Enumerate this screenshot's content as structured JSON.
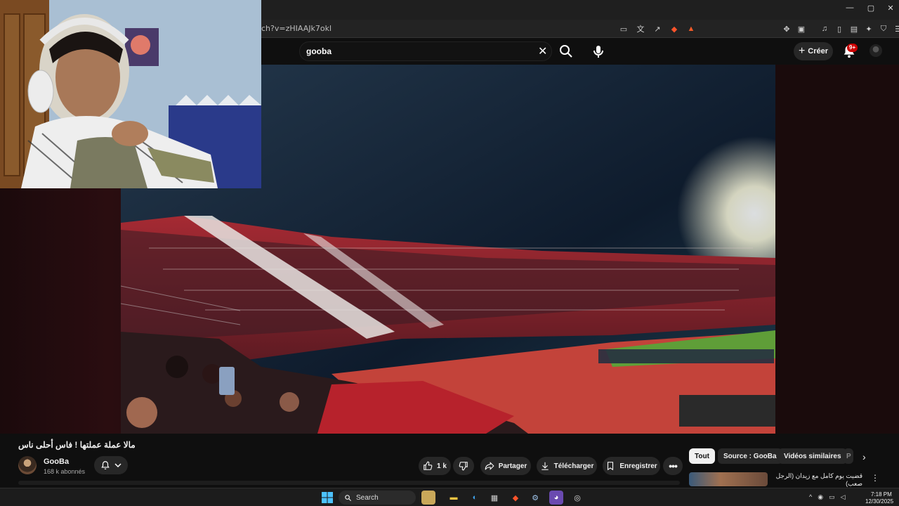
{
  "browser": {
    "url": "ch?v=zHIAAJk7okl",
    "window_controls": [
      "minimize",
      "maximize",
      "close"
    ]
  },
  "header": {
    "search_value": "gooba",
    "create_label": "Créer",
    "notif_count": "9+"
  },
  "video": {
    "title": "مالا عملة عملتها ! فاس أحلى ناس",
    "channel_name": "GooBa",
    "subscribers": "168 k abonnés"
  },
  "actions": {
    "likes": "1 k",
    "share": "Partager",
    "download": "Télécharger",
    "save": "Enregistrer"
  },
  "chips": {
    "all": "Tout",
    "source": "Source : GooBa",
    "similar": "Vidéos similaires",
    "partial": "P"
  },
  "recommendation": {
    "title": "قضيت يوم كامل مع زيدان (الرجل صعب)"
  },
  "taskbar": {
    "search_label": "Search",
    "time": "7:18 PM",
    "date": "12/30/2025"
  },
  "colors": {
    "accent": "#cc0000",
    "background": "#0f0f0f",
    "pill": "#272727"
  }
}
